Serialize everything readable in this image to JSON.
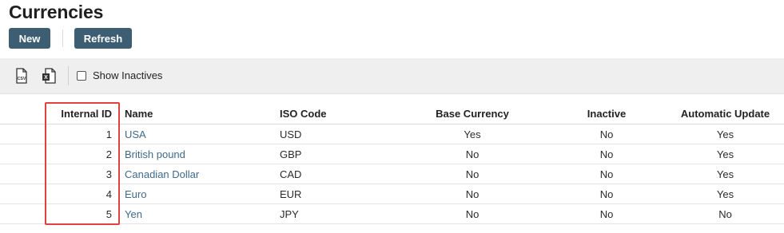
{
  "page": {
    "title": "Currencies"
  },
  "buttons": {
    "new_label": "New",
    "refresh_label": "Refresh"
  },
  "toolbar": {
    "icons": [
      "csv-export-icon",
      "excel-export-icon"
    ],
    "show_inactives_label": "Show Inactives",
    "show_inactives_checked": false
  },
  "table": {
    "headers": {
      "internal_id": "Internal ID",
      "name": "Name",
      "iso_code": "ISO Code",
      "base_currency": "Base Currency",
      "inactive": "Inactive",
      "automatic_update": "Automatic Update"
    },
    "rows": [
      {
        "internal_id": "1",
        "name": "USA",
        "iso_code": "USD",
        "base_currency": "Yes",
        "inactive": "No",
        "automatic_update": "Yes"
      },
      {
        "internal_id": "2",
        "name": "British pound",
        "iso_code": "GBP",
        "base_currency": "No",
        "inactive": "No",
        "automatic_update": "Yes"
      },
      {
        "internal_id": "3",
        "name": "Canadian Dollar",
        "iso_code": "CAD",
        "base_currency": "No",
        "inactive": "No",
        "automatic_update": "Yes"
      },
      {
        "internal_id": "4",
        "name": "Euro",
        "iso_code": "EUR",
        "base_currency": "No",
        "inactive": "No",
        "automatic_update": "Yes"
      },
      {
        "internal_id": "5",
        "name": "Yen",
        "iso_code": "JPY",
        "base_currency": "No",
        "inactive": "No",
        "automatic_update": "No"
      }
    ]
  },
  "colors": {
    "button_bg": "#3d5d73",
    "link": "#3e6a8c",
    "highlight_border": "#e0413c",
    "toolbar_bg": "#efefef"
  }
}
